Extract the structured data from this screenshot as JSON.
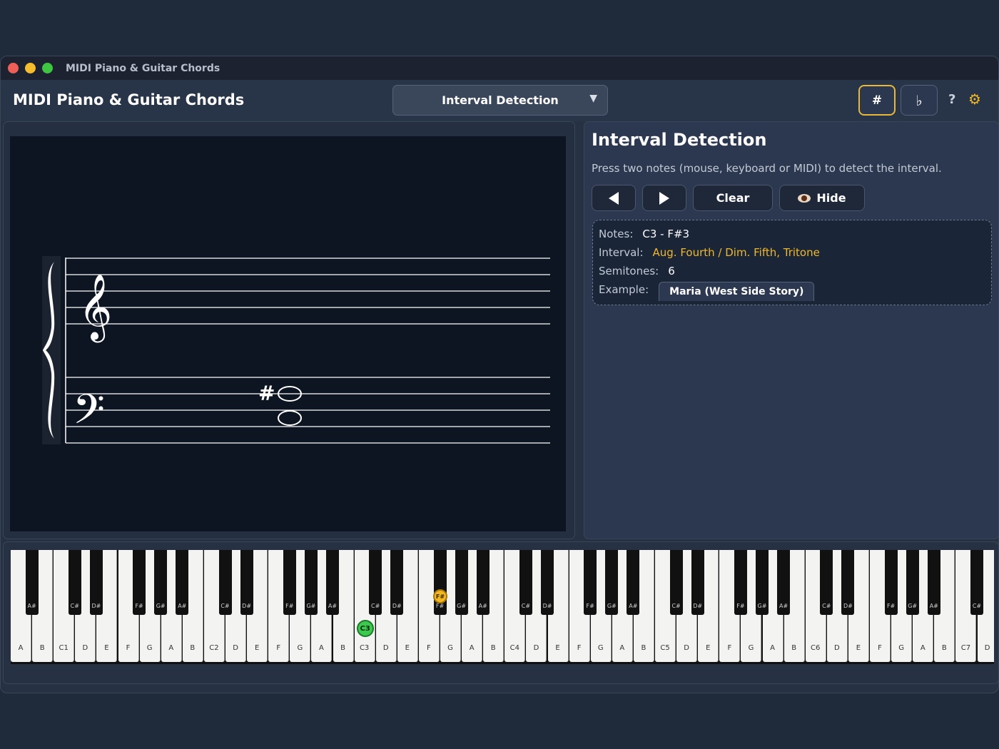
{
  "window": {
    "title": "MIDI Piano & Guitar Chords"
  },
  "header": {
    "app_title": "MIDI Piano & Guitar Chords",
    "mode": "Interval Detection",
    "mode_caret": "▼",
    "sharp_label": "#",
    "flat_label": "♭",
    "help_label": "?",
    "settings_label": "⚙",
    "accent_color": "#e9b73a"
  },
  "staff": {
    "accidental": "#",
    "treble_clef": "𝄞",
    "bass_clef": "𝄢"
  },
  "info": {
    "title": "Interval Detection",
    "description": "Press two notes (mouse, keyboard or MIDI) to detect the interval.",
    "clear_label": "Clear",
    "hide_label": "Hide",
    "notes_label": "Notes:",
    "notes_value": "C3 - F#3",
    "interval_label": "Interval:",
    "interval_value": "Aug. Fourth / Dim. Fifth, Tritone",
    "semitones_label": "Semitones:",
    "semitones_value": "6",
    "example_label": "Example:",
    "example_value": "Maria (West Side Story)"
  },
  "keyboard": {
    "white_keys": [
      "A",
      "B",
      "C1",
      "D",
      "E",
      "F",
      "G",
      "A",
      "B",
      "C2",
      "D",
      "E",
      "F",
      "G",
      "A",
      "B",
      "C3",
      "D",
      "E",
      "F",
      "G",
      "A",
      "B",
      "C4",
      "D",
      "E",
      "F",
      "G",
      "A",
      "B",
      "C5",
      "D",
      "E",
      "F",
      "G",
      "A",
      "B",
      "C6",
      "D",
      "E",
      "F",
      "G",
      "A",
      "B",
      "C7",
      "D"
    ],
    "black_keys": [
      "A#",
      "C#",
      "D#",
      "F#",
      "G#",
      "A#",
      "C#",
      "D#",
      "F#",
      "G#",
      "A#",
      "C#",
      "D#",
      "F#",
      "G#",
      "A#",
      "C#",
      "D#",
      "F#",
      "G#",
      "A#",
      "C#",
      "D#",
      "F#",
      "G#",
      "A#",
      "C#",
      "D#",
      "F#",
      "G#",
      "A#",
      "C#"
    ],
    "active_notes": [
      {
        "note": "C3",
        "label": "C3",
        "color": "#3cc94e"
      },
      {
        "note": "F#3",
        "label": "F#",
        "color": "#f2b824"
      }
    ]
  }
}
